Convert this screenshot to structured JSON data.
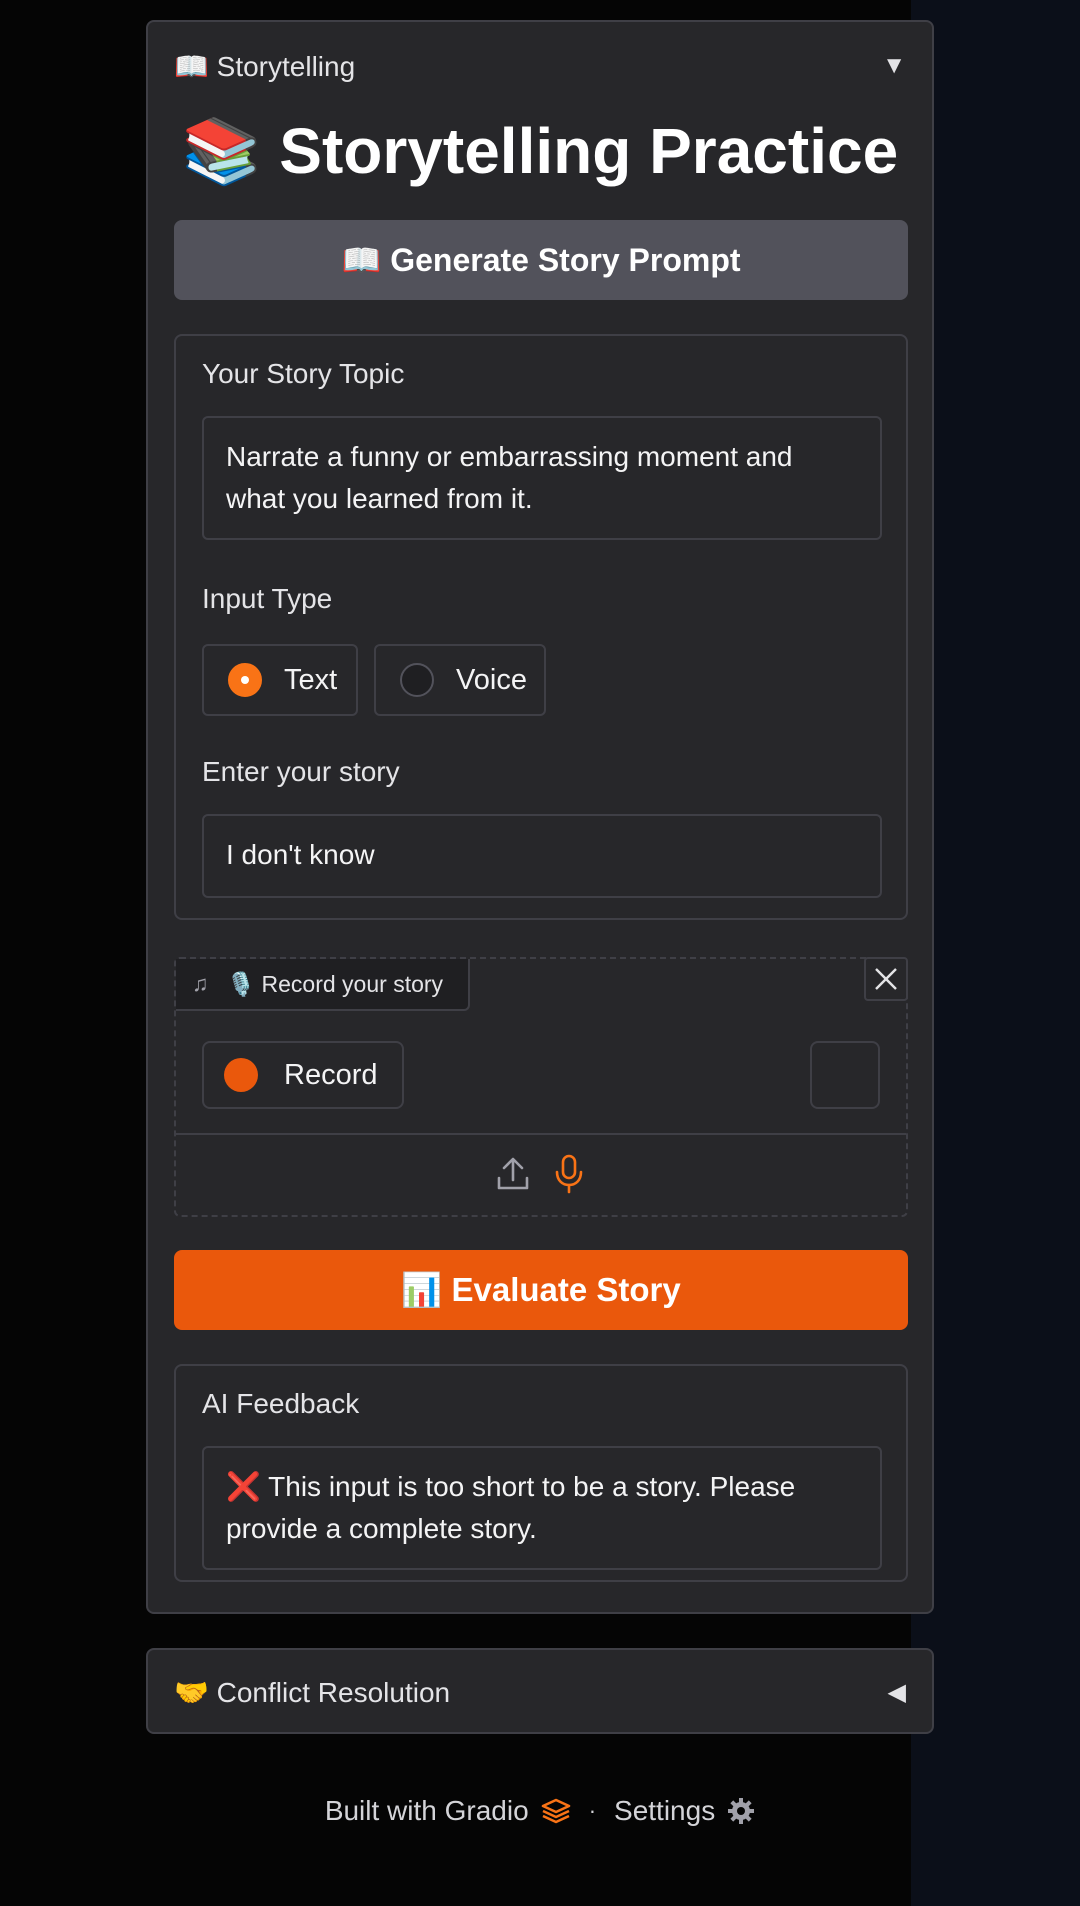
{
  "storytelling_accordion": {
    "header_label": "📖 Storytelling",
    "toggle_glyph": "▼",
    "title": "📚 Storytelling Practice",
    "generate_button": "📖 Generate Story Prompt",
    "topic": {
      "label": "Your Story Topic",
      "value": "Narrate a funny or embarrassing moment and what you learned from it."
    },
    "input_type": {
      "label": "Input Type",
      "options": [
        "Text",
        "Voice"
      ],
      "selected": "Text"
    },
    "story_input": {
      "label": "Enter your story",
      "value": "I don't know"
    },
    "audio": {
      "label": "🎙️ Record your story",
      "note_glyph": "♫",
      "record_label": "Record"
    },
    "evaluate_button": "📊 Evaluate Story",
    "feedback": {
      "label": "AI Feedback",
      "value": "❌ This input is too short to be a story. Please provide a complete story."
    }
  },
  "conflict_accordion": {
    "header_label": "🤝 Conflict Resolution",
    "toggle_glyph": "◀"
  },
  "footer": {
    "built_with": "Built with Gradio",
    "separator": "·",
    "settings": "Settings"
  },
  "colors": {
    "accent": "#ea580c",
    "panel": "#27272a",
    "border": "#3f3f46",
    "secondary_button": "#52525b"
  }
}
